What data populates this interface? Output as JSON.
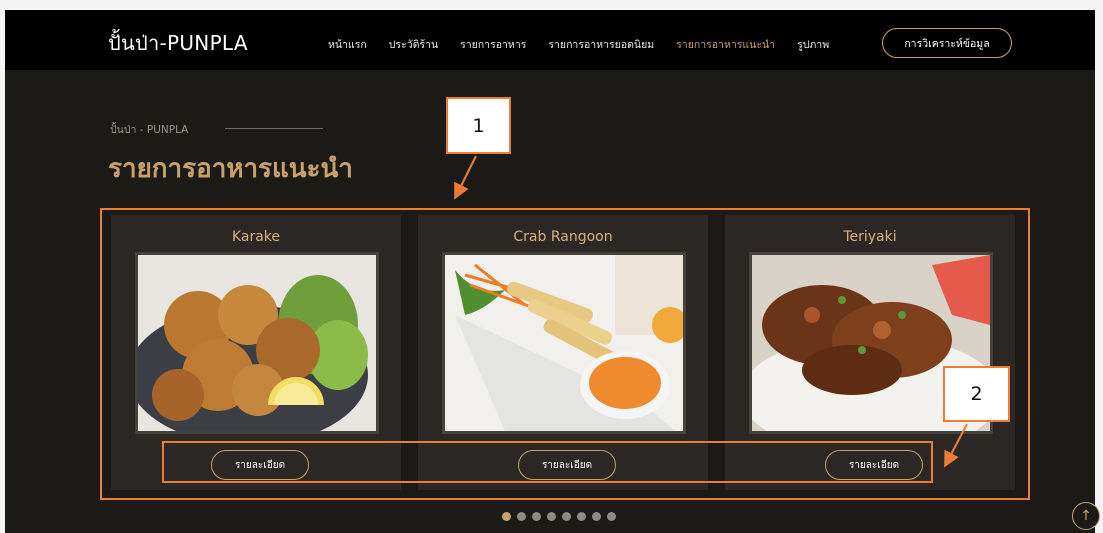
{
  "nav": {
    "logo": "ปั้นป่า-PUNPLA",
    "items": [
      {
        "label": "หน้าแรก"
      },
      {
        "label": "ประวัติร้าน"
      },
      {
        "label": "รายการอาหาร"
      },
      {
        "label": "รายการอาหารยอดนิยม"
      },
      {
        "label": "รายการอาหารแนะนำ",
        "active": true
      },
      {
        "label": "รูปภาพ"
      }
    ],
    "analysis_button": "การวิเคราะห์ข้อมูล"
  },
  "section": {
    "breadcrumb": "ปั้นป่า - PUNPLA",
    "title": "รายการอาหารแนะนำ"
  },
  "cards": [
    {
      "title": "Karake",
      "detail_button": "รายละเอียด",
      "image": "fried-chicken-karaage-photo"
    },
    {
      "title": "Crab Rangoon",
      "detail_button": "รายละเอียด",
      "image": "spring-rolls-with-sauce-photo"
    },
    {
      "title": "Teriyaki",
      "detail_button": "รายละเอียด",
      "image": "teriyaki-chicken-rice-photo"
    }
  ],
  "annotations": [
    {
      "label": "1"
    },
    {
      "label": "2"
    }
  ],
  "carousel": {
    "dot_count": 8,
    "active_index": 0
  },
  "back_to_top_icon": "arrow-up-icon",
  "colors": {
    "accent": "#c8a06a",
    "annotation": "#ee7d32",
    "background": "#1c1a17",
    "nav": "#000000"
  }
}
